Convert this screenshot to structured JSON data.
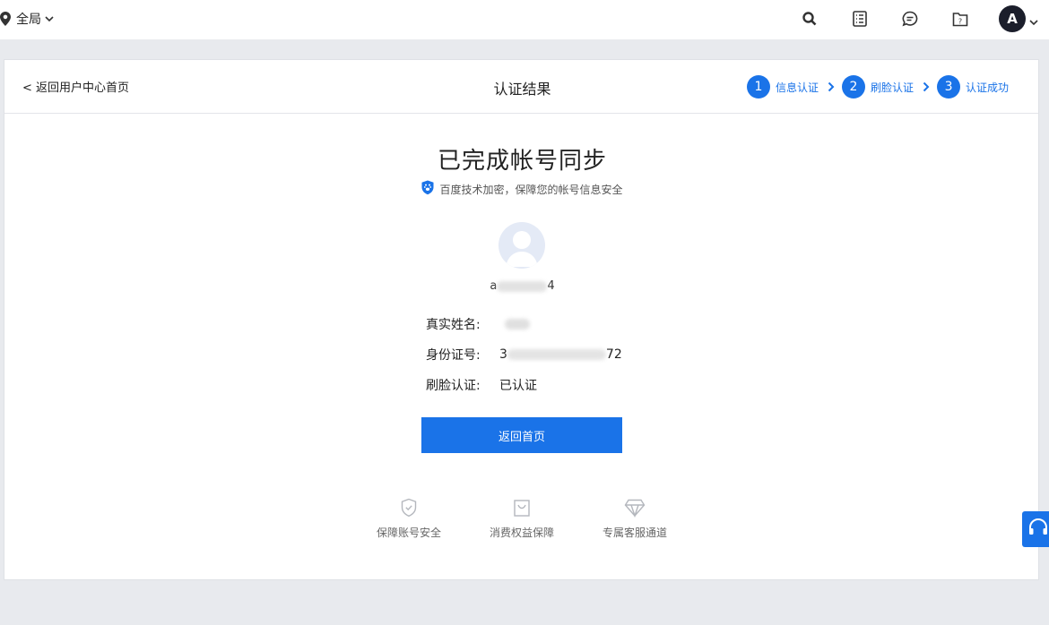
{
  "topbar": {
    "location": "全局",
    "icons": [
      "search-icon",
      "list-icon",
      "message-icon",
      "help-folder-icon"
    ],
    "avatar_letter": "A"
  },
  "header": {
    "back_link": "< 返回用户中心首页",
    "title": "认证结果",
    "steps": [
      {
        "num": "1",
        "label": "信息认证"
      },
      {
        "num": "2",
        "label": "刷脸认证"
      },
      {
        "num": "3",
        "label": "认证成功"
      }
    ]
  },
  "result": {
    "title": "已完成帐号同步",
    "subtitle": "百度技术加密，保障您的帐号信息安全",
    "username_start": "a",
    "username_end": "4",
    "rows": [
      {
        "label": "真实姓名:",
        "value": ""
      },
      {
        "label": "身份证号:",
        "value_start": "3",
        "value_end": "72"
      },
      {
        "label": "刷脸认证:",
        "value": "已认证"
      }
    ],
    "button": "返回首页"
  },
  "features": [
    {
      "label": "保障账号安全"
    },
    {
      "label": "消费权益保障"
    },
    {
      "label": "专属客服通道"
    }
  ],
  "colors": {
    "accent": "#1a73e8"
  }
}
